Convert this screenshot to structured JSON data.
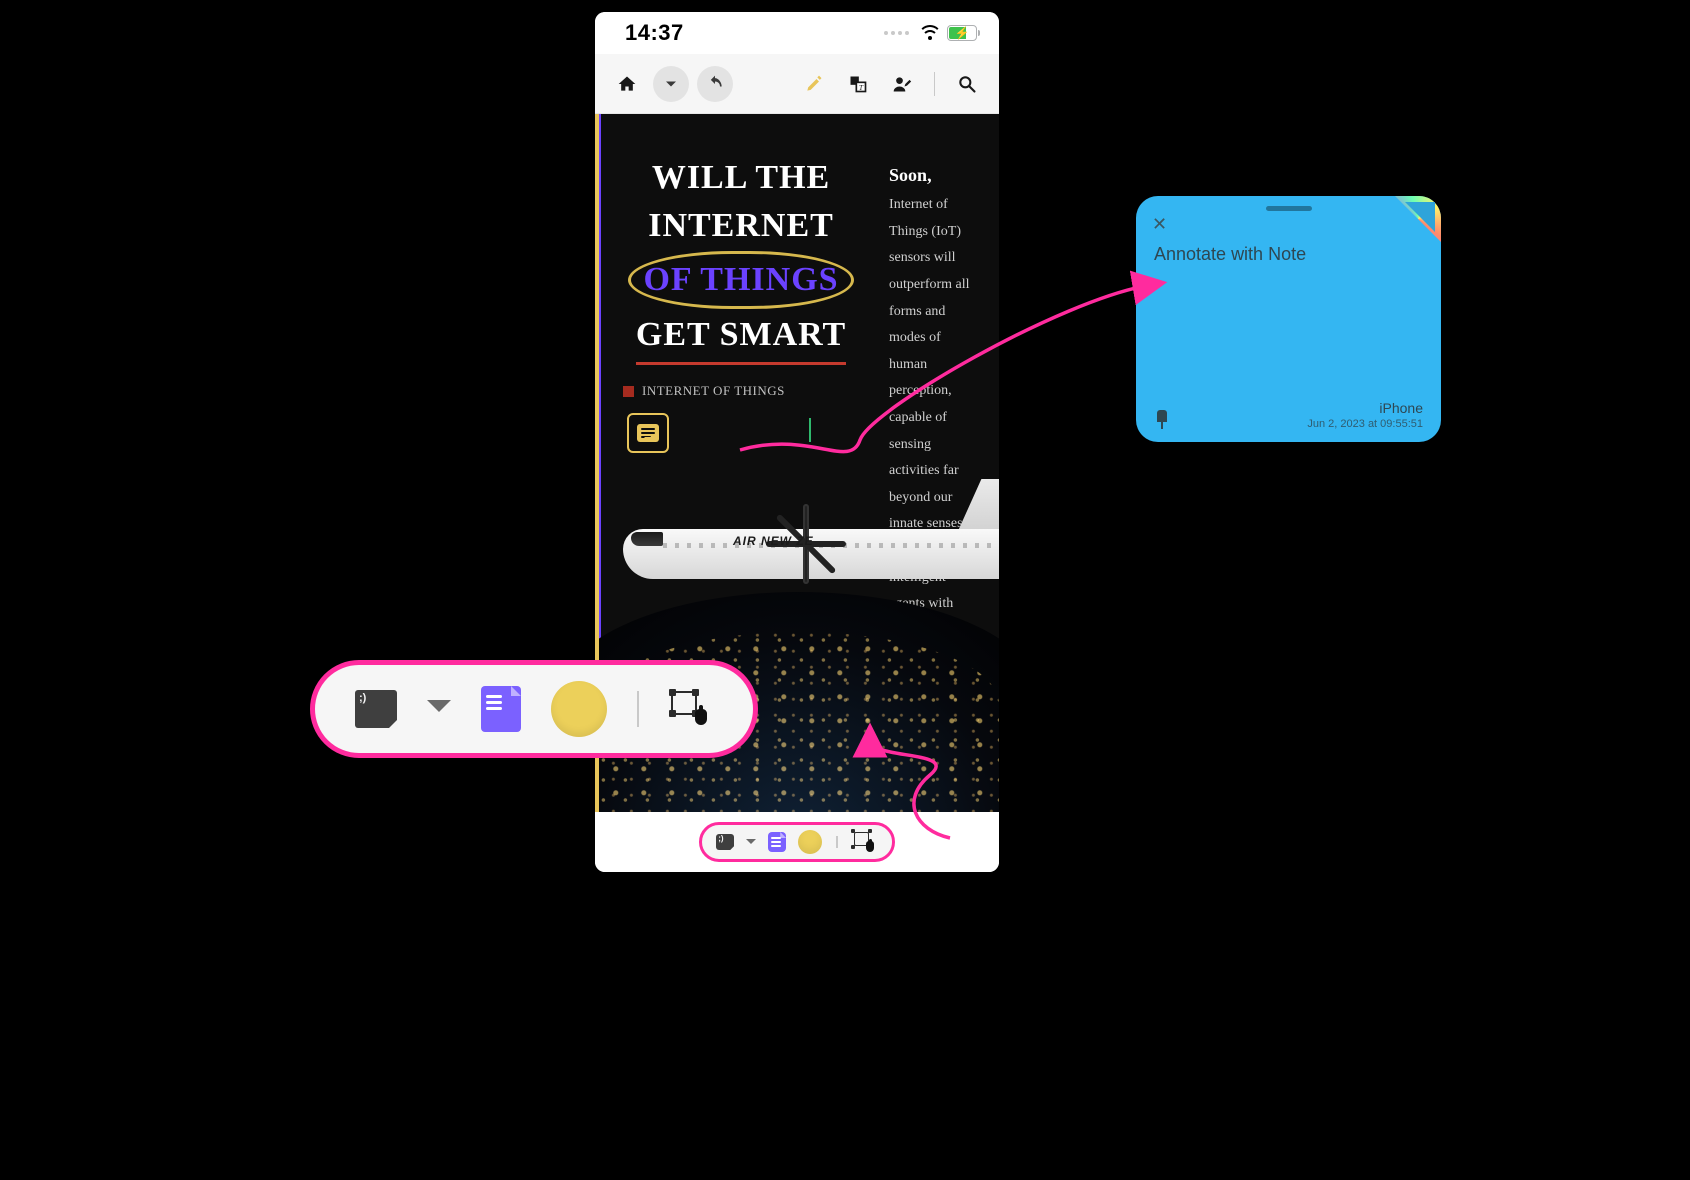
{
  "statusbar": {
    "time": "14:37"
  },
  "app_toolbar": {
    "icons": [
      "home",
      "chevron-down",
      "undo",
      "highlighter",
      "text-box",
      "avatar-edit",
      "search"
    ]
  },
  "document": {
    "headline": {
      "line1": "WILL THE",
      "line2": "INTERNET",
      "line3": "OF THINGS",
      "line4": "GET SMART"
    },
    "tag": "INTERNET OF THINGS",
    "intro_lead": "Soon,",
    "intro_body": " Internet of Things (IoT) sensors will outperform all forms and modes of human perception, capable of sensing activities far beyond our innate senses. As these intelligent agents with sensors could conspire to seize control of infrastructure assets, humans could indeed be severely marginalized.",
    "airline": "AIR NEW ZE"
  },
  "note": {
    "title": "Annotate  with Note",
    "device": "iPhone",
    "timestamp": "Jun 2, 2023 at 09:55:51"
  },
  "dock": {
    "sticky": "sticky-note",
    "chevron": "expand",
    "page": "document",
    "swatch_color": "#ecd05a",
    "transform": "transform-selection"
  },
  "colors": {
    "accent_pink": "#ff2b9e",
    "accent_purple": "#7B61FF",
    "accent_gold": "#e8c55a",
    "note_blue": "#34b6f2"
  }
}
